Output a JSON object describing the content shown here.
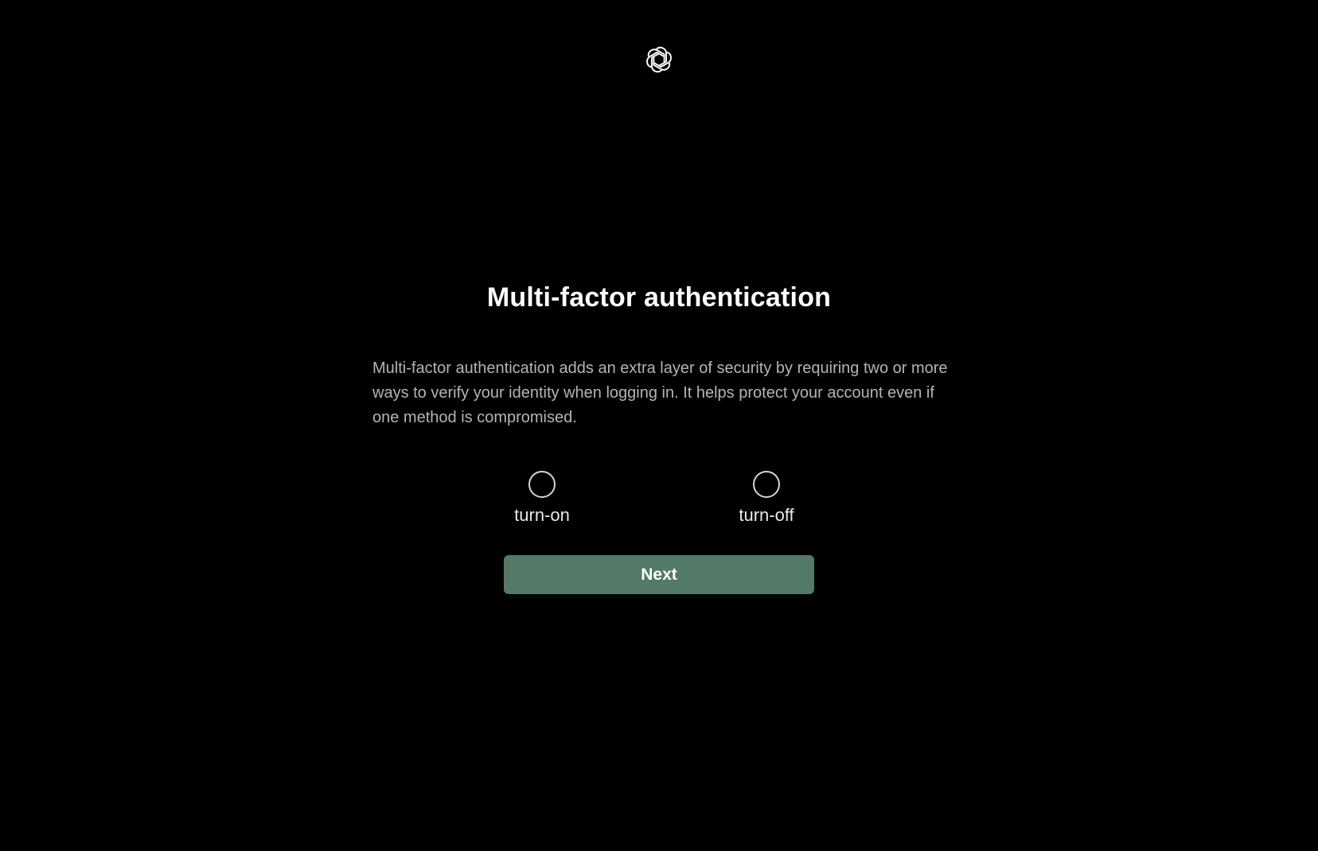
{
  "header": {
    "logo": "openai-logo-icon"
  },
  "main": {
    "title": "Multi-factor authentication",
    "description": "Multi-factor authentication adds an extra layer of security by requiring two or more ways to verify your identity when logging in. It helps protect your account even if one method is compromised.",
    "options": [
      {
        "label": "turn-on",
        "selected": false
      },
      {
        "label": "turn-off",
        "selected": false
      }
    ],
    "next_label": "Next"
  },
  "colors": {
    "background": "#000000",
    "accent": "#527a66",
    "text_primary": "#ffffff",
    "text_secondary": "#b4b4b4"
  }
}
